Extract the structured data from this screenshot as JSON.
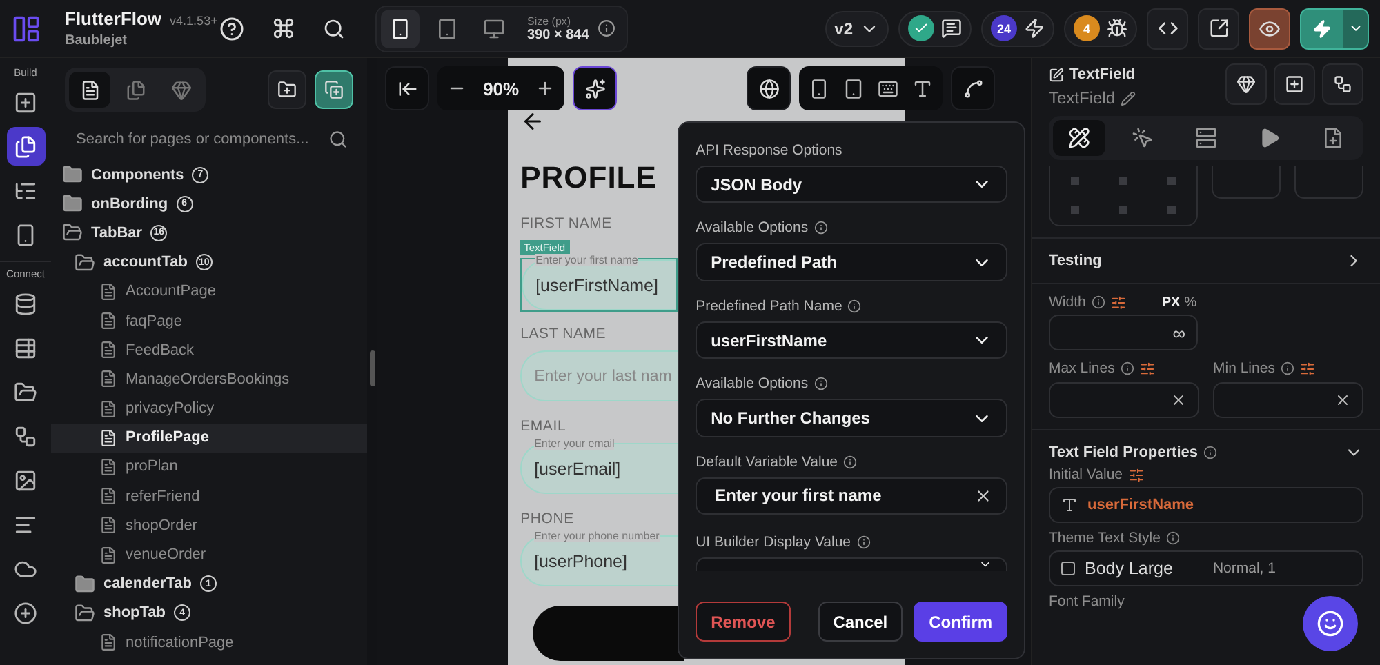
{
  "header": {
    "app_name": "FlutterFlow",
    "version": "v4.1.53+",
    "project": "Baublejet",
    "devices": [
      {
        "kind": "phone",
        "selected": true
      },
      {
        "kind": "tablet",
        "selected": false
      },
      {
        "kind": "desktop",
        "selected": false
      }
    ],
    "size_label": "Size (px)",
    "size_value": "390 × 844",
    "branch": "v2",
    "build_count": "24",
    "issue_count": "4"
  },
  "rail": {
    "sections": [
      {
        "label": "Build",
        "items": [
          {
            "kind": "add-widget",
            "selected": false
          },
          {
            "kind": "pages",
            "selected": true
          },
          {
            "kind": "tree",
            "selected": false
          },
          {
            "kind": "storyboard",
            "selected": false
          }
        ]
      },
      {
        "label": "Connect",
        "items": [
          {
            "kind": "data",
            "selected": false
          },
          {
            "kind": "schema",
            "selected": false
          },
          {
            "kind": "files",
            "selected": false
          },
          {
            "kind": "integrations",
            "selected": false
          },
          {
            "kind": "media",
            "selected": false
          },
          {
            "kind": "text",
            "selected": false
          },
          {
            "kind": "cloud",
            "selected": false
          },
          {
            "kind": "check",
            "selected": false
          }
        ]
      }
    ]
  },
  "sidebar": {
    "tabs": [
      {
        "kind": "pages",
        "selected": true
      },
      {
        "kind": "components",
        "selected": false
      },
      {
        "kind": "library",
        "selected": false
      }
    ],
    "search": {
      "placeholder": "Search for pages or components..."
    },
    "tree": [
      {
        "kind": "folder",
        "label": "Components",
        "count": "7",
        "expanded": false
      },
      {
        "kind": "folder",
        "label": "onBording",
        "count": "6",
        "expanded": false
      },
      {
        "kind": "folder",
        "label": "TabBar",
        "count": "16",
        "expanded": true,
        "children": [
          {
            "kind": "folder",
            "label": "accountTab",
            "count": "10",
            "expanded": true,
            "children": [
              {
                "kind": "page",
                "label": "AccountPage",
                "selected": false
              },
              {
                "kind": "page",
                "label": "faqPage",
                "selected": false
              },
              {
                "kind": "page",
                "label": "FeedBack",
                "selected": false
              },
              {
                "kind": "page",
                "label": "ManageOrdersBookings",
                "selected": false
              },
              {
                "kind": "page",
                "label": "privacyPolicy",
                "selected": false
              },
              {
                "kind": "page",
                "label": "ProfilePage",
                "selected": true
              },
              {
                "kind": "page",
                "label": "proPlan",
                "selected": false
              },
              {
                "kind": "page",
                "label": "referFriend",
                "selected": false
              },
              {
                "kind": "page",
                "label": "shopOrder",
                "selected": false
              },
              {
                "kind": "page",
                "label": "venueOrder",
                "selected": false
              }
            ]
          },
          {
            "kind": "folder",
            "label": "calenderTab",
            "count": "1",
            "expanded": false
          },
          {
            "kind": "folder",
            "label": "shopTab",
            "count": "4",
            "expanded": true,
            "children": [
              {
                "kind": "page",
                "label": "notificationPage",
                "selected": false
              }
            ]
          }
        ]
      }
    ]
  },
  "canvas": {
    "zoom": "90%",
    "phone": {
      "title": "PROFILE",
      "fields": [
        {
          "label": "FIRST NAME",
          "floating": "Enter your first name",
          "value": "[userFirstName]",
          "selected": true,
          "tag": "TextField"
        },
        {
          "label": "LAST NAME",
          "placeholder": "Enter your last nam",
          "selected": false
        },
        {
          "label": "EMAIL",
          "floating": "Enter your email",
          "value": "[userEmail]",
          "selected": false
        },
        {
          "label": "PHONE",
          "floating": "Enter your phone number",
          "value": "[userPhone]",
          "selected": false
        }
      ]
    }
  },
  "dialog": {
    "fields": [
      {
        "label": "API Response Options",
        "info": false,
        "kind": "select",
        "value": "JSON Body"
      },
      {
        "label": "Available Options",
        "info": true,
        "kind": "select",
        "value": "Predefined Path"
      },
      {
        "label": "Predefined Path Name",
        "info": true,
        "kind": "select",
        "value": "userFirstName"
      },
      {
        "label": "Available Options",
        "info": true,
        "kind": "select",
        "value": "No Further Changes"
      },
      {
        "label": "Default Variable Value",
        "info": true,
        "kind": "input",
        "value": "Enter your first name"
      },
      {
        "label": "UI Builder Display Value",
        "info": true,
        "kind": "select"
      }
    ],
    "buttons": [
      {
        "kind": "danger",
        "label": "Remove"
      },
      {
        "kind": "plain",
        "label": "Cancel"
      },
      {
        "kind": "primary",
        "label": "Confirm"
      }
    ]
  },
  "properties": {
    "widget_type": "TextField",
    "widget_name": "TextField",
    "tabs": [
      {
        "kind": "style",
        "selected": true
      },
      {
        "kind": "actions",
        "selected": false
      },
      {
        "kind": "backend",
        "selected": false
      },
      {
        "kind": "animation",
        "selected": false
      },
      {
        "kind": "docs",
        "selected": false
      }
    ],
    "testing": "Testing",
    "width_label": "Width",
    "units": [
      {
        "label": "PX",
        "selected": true
      },
      {
        "label": "%",
        "selected": false
      }
    ],
    "width_value": "∞",
    "max_lines_label": "Max Lines",
    "min_lines_label": "Min Lines",
    "section_title": "Text Field Properties",
    "initial_value_label": "Initial Value",
    "initial_value": "userFirstName",
    "theme_style_label": "Theme Text Style",
    "theme_style": "Body Large",
    "theme_style_detail": "Normal, 1",
    "font_family_label": "Font Family"
  }
}
